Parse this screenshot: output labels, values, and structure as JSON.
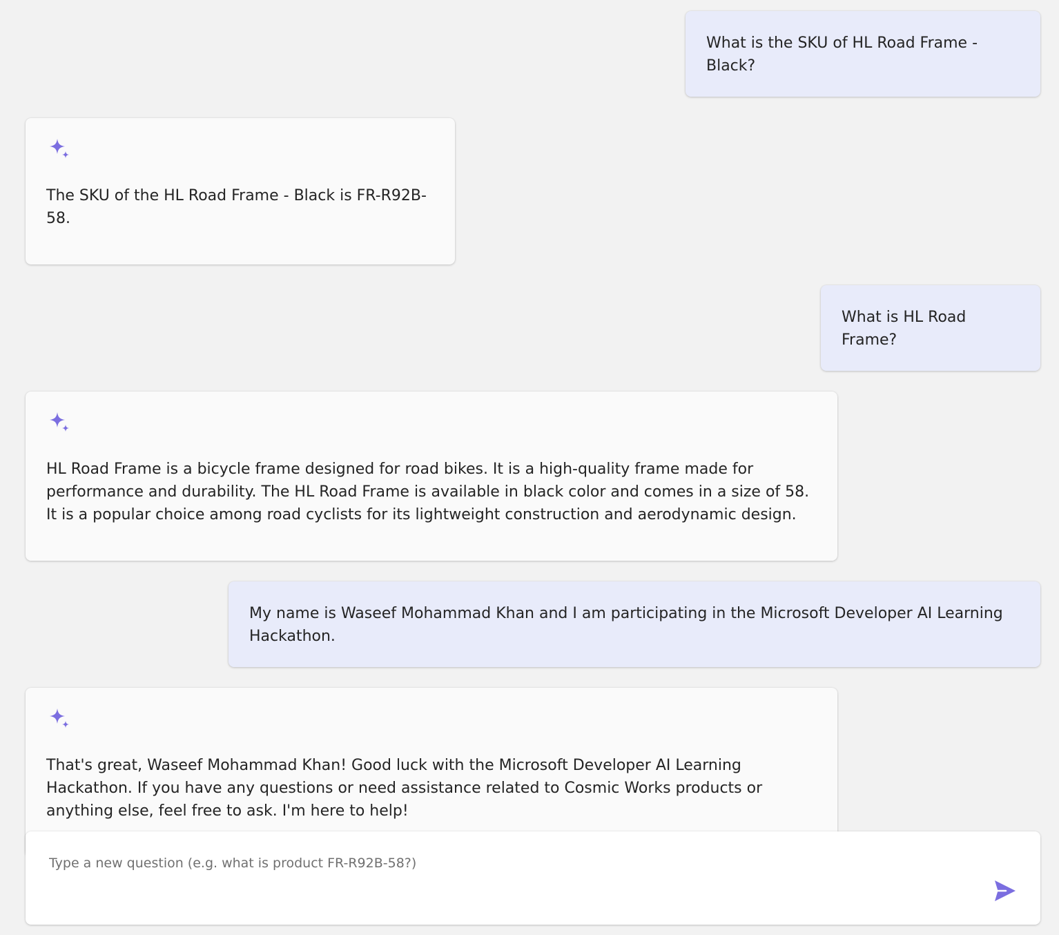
{
  "colors": {
    "background": "#f2f2f2",
    "user_bubble": "#e8ebfa",
    "assistant_bubble": "#fafafa",
    "accent": "#7b6ee0"
  },
  "messages": [
    {
      "role": "user",
      "text": "What is the SKU of HL Road Frame - Black?"
    },
    {
      "role": "assistant",
      "icon": "sparkle-icon",
      "text": "The SKU of the HL Road Frame - Black is FR-R92B-58."
    },
    {
      "role": "user",
      "text": "What is HL Road Frame?"
    },
    {
      "role": "assistant",
      "icon": "sparkle-icon",
      "text": "HL Road Frame is a bicycle frame designed for road bikes. It is a high-quality frame made for performance and durability. The HL Road Frame is available in black color and comes in a size of 58. It is a popular choice among road cyclists for its lightweight construction and aerodynamic design."
    },
    {
      "role": "user",
      "text": "My name is Waseef Mohammad Khan and I am participating in the Microsoft Developer AI Learning Hackathon."
    },
    {
      "role": "assistant",
      "icon": "sparkle-icon",
      "text": "That's great, Waseef Mohammad Khan! Good luck with the Microsoft Developer AI Learning Hackathon. If you have any questions or need assistance related to Cosmic Works products or anything else, feel free to ask. I'm here to help!"
    }
  ],
  "composer": {
    "value": "",
    "placeholder": "Type a new question (e.g. what is product FR-R92B-58?)",
    "send_icon": "send-icon"
  }
}
